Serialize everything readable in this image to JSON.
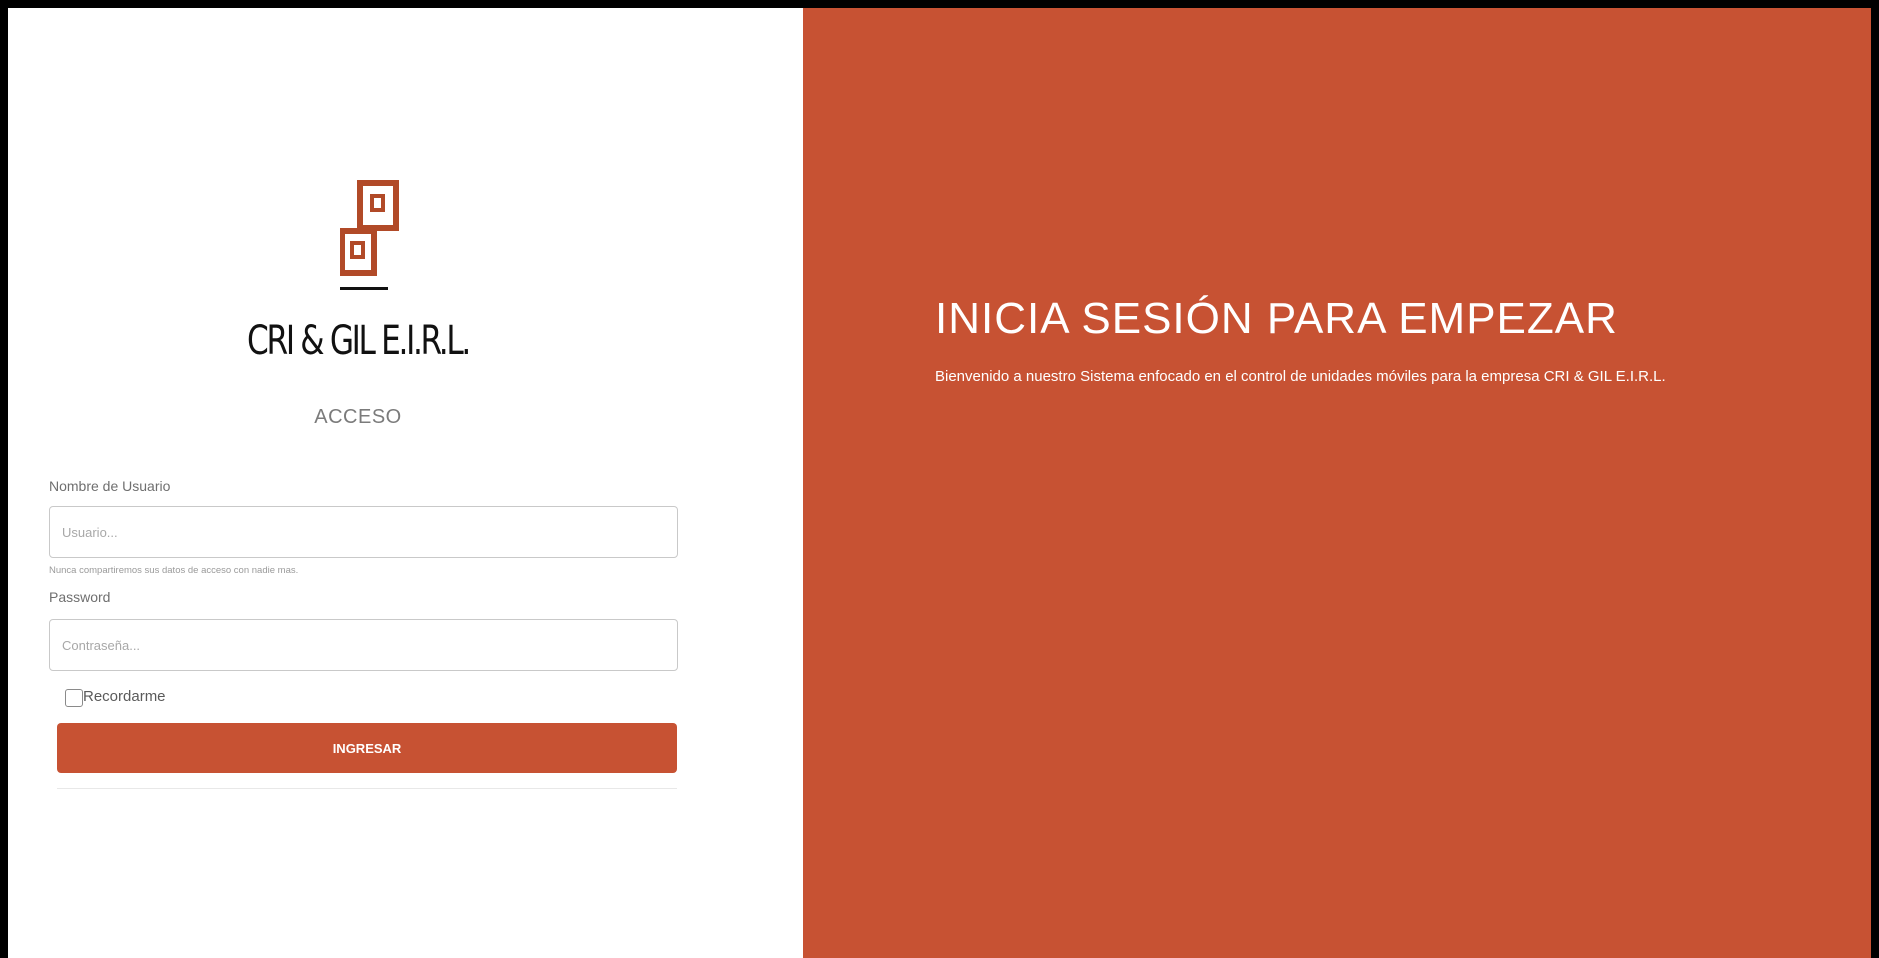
{
  "brand": {
    "name": "CRI & GIL E.I.R.L.",
    "logo_icon": "interlocking-squares-logo-icon",
    "accent_color": "#c75233"
  },
  "login": {
    "heading": "ACCESO",
    "username_label": "Nombre de Usuario",
    "username_placeholder": "Usuario...",
    "username_help": "Nunca compartiremos sus datos de acceso con nadie mas.",
    "password_label": "Password",
    "password_placeholder": "Contraseña...",
    "remember_label": "Recordarme",
    "remember_checked": false,
    "submit_label": "INGRESAR"
  },
  "hero": {
    "title": "INICIA SESIÓN PARA EMPEZAR",
    "subtitle": "Bienvenido a nuestro Sistema enfocado en el control de unidades móviles para la empresa CRI & GIL E.I.R.L.",
    "background_color": "#c75233"
  }
}
